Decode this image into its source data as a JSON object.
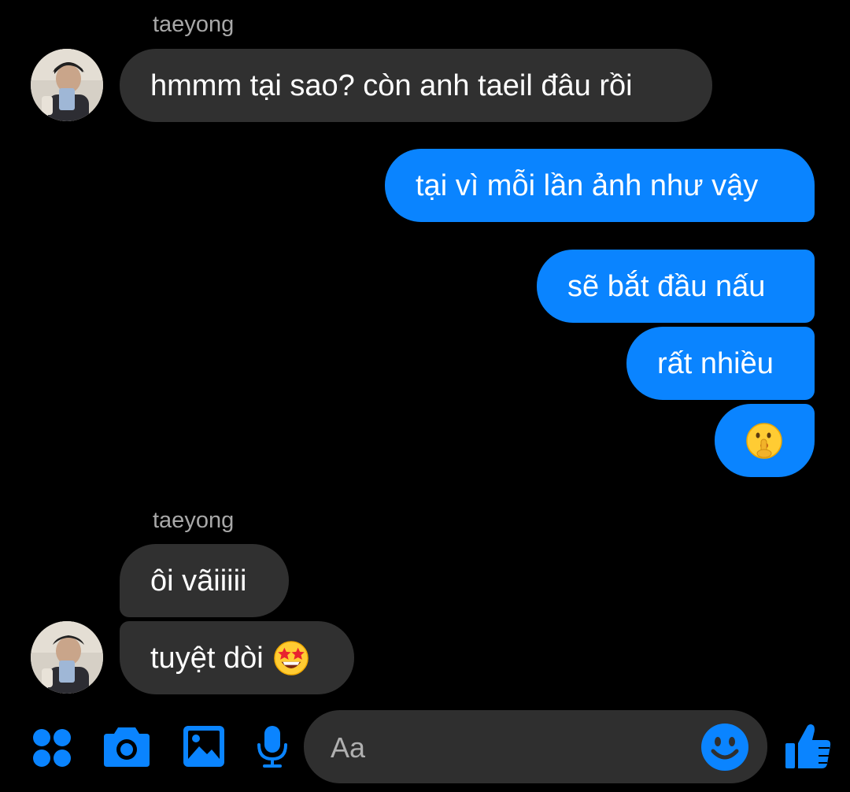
{
  "messages": [
    {
      "sender": "taeyong",
      "text": "hmmm tại sao? còn anh taeil đâu rồi"
    },
    {
      "text": "tại vì mỗi lần ảnh như vậy"
    },
    {
      "text": "sẽ bắt đầu nấu"
    },
    {
      "text": "rất nhiều"
    },
    {
      "emoji": "shushing-face"
    },
    {
      "sender": "taeyong",
      "text": "ôi vãiiiii"
    },
    {
      "text": "tuyệt dòi",
      "emoji": "star-struck"
    }
  ],
  "composer": {
    "placeholder": "Aa"
  },
  "toolbar": {
    "icons": [
      "menu-dots-icon",
      "camera-icon",
      "gallery-icon",
      "microphone-icon",
      "emoji-icon",
      "thumbs-up-icon"
    ]
  },
  "colors": {
    "accent": "#0a84ff",
    "incoming_bubble": "#303030",
    "background": "#000000",
    "sender_name": "#a8a8a8",
    "composer": "#2f2f2f"
  }
}
